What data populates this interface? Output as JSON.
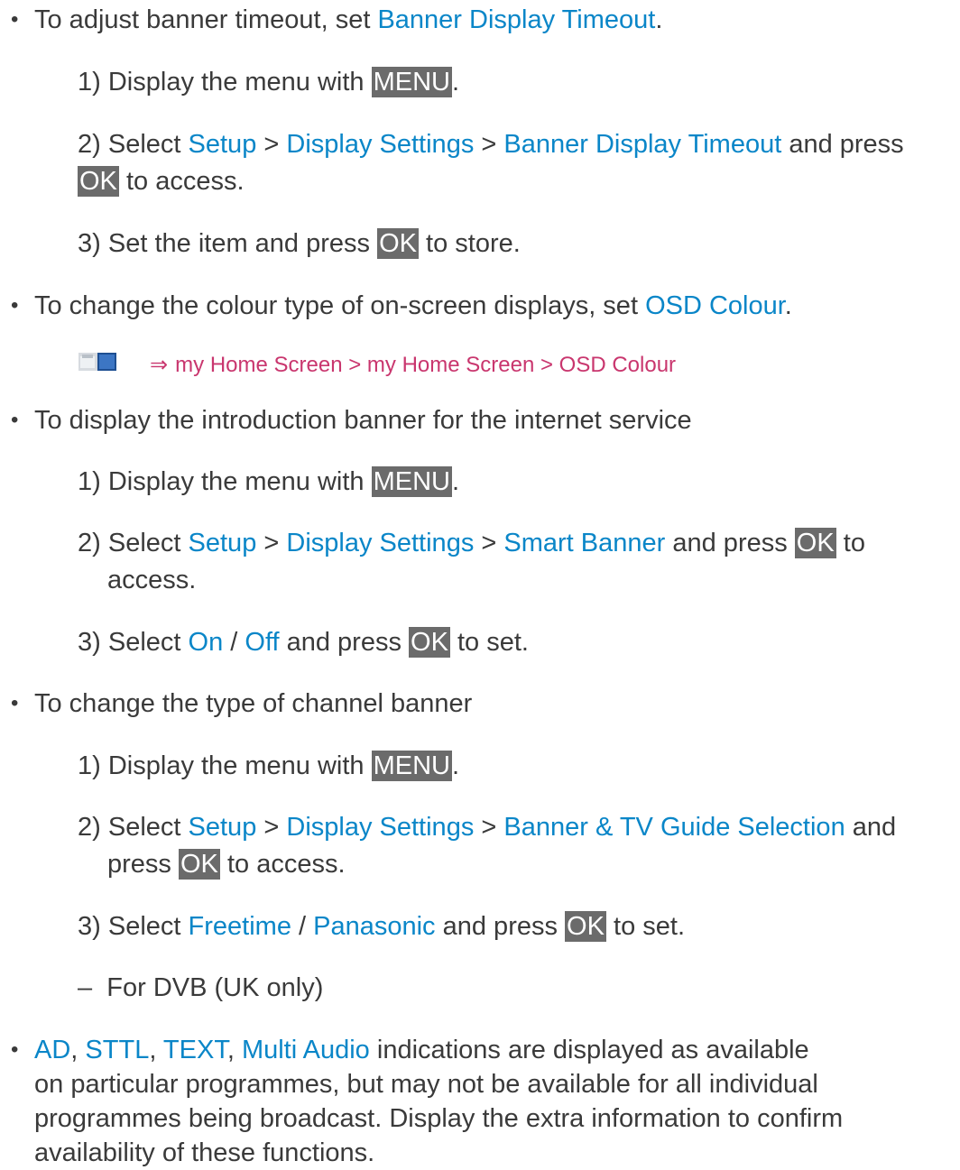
{
  "colors": {
    "text": "#3a3a3a",
    "link": "#0a86c8",
    "key_bg": "#6b6b6b",
    "crumb": "#c9366e"
  },
  "bullet_glyph": "•",
  "b1": {
    "pre": "To adjust banner timeout, set ",
    "link": "Banner Display Timeout",
    "post": ".",
    "s1": {
      "num": "1)",
      "pre": "Display the menu with ",
      "key": "MENU",
      "post": "."
    },
    "s2": {
      "num": "2)",
      "select": "Select ",
      "setup": "Setup",
      "sep1": " > ",
      "display": "Display Settings",
      "sep2": " > ",
      "item": "Banner Display Timeout",
      "tail": " and press",
      "key": "OK",
      "access": " to access."
    },
    "s3": {
      "num": "3)",
      "pre": "Set the item and press ",
      "key": "OK",
      "post": " to store."
    }
  },
  "b2": {
    "pre": "To change the colour type of on-screen displays, set ",
    "link": "OSD Colour",
    "post": ".",
    "crumb": "my Home Screen > my Home Screen > OSD Colour"
  },
  "b3": {
    "text": "To display the introduction banner for the internet service",
    "s1": {
      "num": "1)",
      "pre": "Display the menu with ",
      "key": "MENU",
      "post": "."
    },
    "s2": {
      "num": "2)",
      "select": "Select ",
      "setup": "Setup",
      "sep1": " > ",
      "display": "Display Settings",
      "sep2": " > ",
      "item": "Smart Banner",
      "tail": " and press ",
      "key": "OK",
      "to": " to",
      "access": "access."
    },
    "s3": {
      "num": "3)",
      "select": "Select ",
      "on": "On",
      "slash": " / ",
      "off": "Off",
      "mid": " and press ",
      "key": "OK",
      "post": " to set."
    }
  },
  "b4": {
    "text": "To change the type of channel banner",
    "s1": {
      "num": "1)",
      "pre": "Display the menu with ",
      "key": "MENU",
      "post": "."
    },
    "s2": {
      "num": "2)",
      "select": "Select ",
      "setup": "Setup",
      "sep1": " > ",
      "display": "Display Settings",
      "sep2": " > ",
      "item": "Banner & TV Guide Selection",
      "tail": " and",
      "press": "press ",
      "key": "OK",
      "access": " to access."
    },
    "s3": {
      "num": "3)",
      "select": "Select ",
      "freetime": "Freetime",
      "slash": " / ",
      "panasonic": "Panasonic",
      "mid": " and press ",
      "key": "OK",
      "post": " to set."
    },
    "note": {
      "dash": "–",
      "text": "For DVB (UK only)"
    }
  },
  "b5": {
    "ad": "AD",
    "c1": ", ",
    "sttl": "STTL",
    "c2": ", ",
    "text": "TEXT",
    "c3": ", ",
    "multi": "Multi Audio",
    "l1": " indications are displayed as available",
    "l2": "on particular programmes, but may not be available for all individual",
    "l3": "programmes being broadcast. Display the extra information to confirm",
    "l4": "availability of these functions."
  }
}
